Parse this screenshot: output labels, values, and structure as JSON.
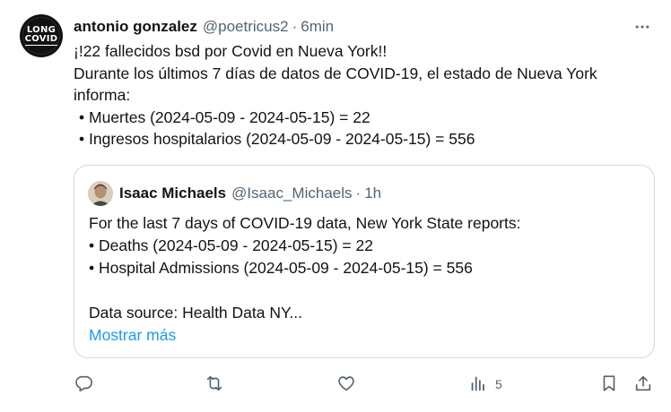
{
  "tweet": {
    "avatar": {
      "line1": "LONG",
      "line2": "COVID"
    },
    "author_name": "antonio gonzalez",
    "author_handle": "@poetricus2",
    "separator": "·",
    "time": "6min",
    "lines": [
      "¡!22 fallecidos bsd por Covid en Nueva York!!",
      "Durante los últimos 7 días de datos de COVID-19, el estado de Nueva York",
      "informa:",
      "• Muertes (2024-05-09 - 2024-05-15) = 22",
      "• Ingresos hospitalarios (2024-05-09 - 2024-05-15) = 556"
    ]
  },
  "quote": {
    "author_name": "Isaac Michaels",
    "author_handle": "@Isaac_Michaels",
    "separator": "·",
    "time": "1h",
    "lines": [
      "For the last 7 days of COVID-19 data, New York State reports:",
      "• Deaths (2024-05-09 - 2024-05-15) = 22",
      "• Hospital Admissions (2024-05-09 - 2024-05-15) = 556"
    ],
    "source_line": "Data source: Health Data NY...",
    "show_more": "Mostrar más"
  },
  "actions": {
    "reply_icon": "reply-icon",
    "retweet_icon": "retweet-icon",
    "like_icon": "heart-icon",
    "views_icon": "analytics-icon",
    "views_count": "5",
    "bookmark_icon": "bookmark-icon",
    "share_icon": "share-icon"
  },
  "colors": {
    "text": "#0f1419",
    "secondary": "#536471",
    "link": "#1d9bf0",
    "border": "#cfd9de"
  }
}
